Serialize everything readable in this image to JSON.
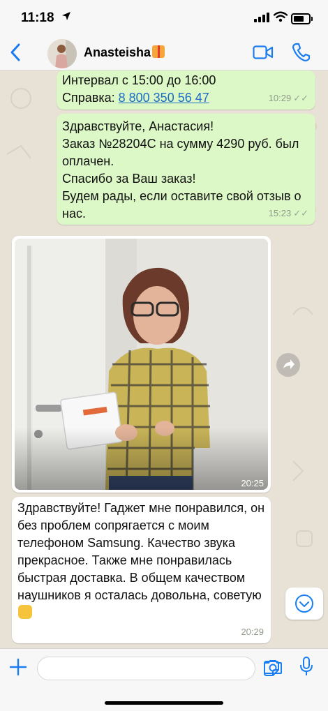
{
  "status_bar": {
    "time": "11:18",
    "location_arrow": "location-arrow-icon"
  },
  "header": {
    "contact_name": "Anasteisha",
    "contact_emoji": "gift-icon",
    "back": "chevron-left-icon",
    "video_call": "video-icon",
    "voice_call": "phone-icon"
  },
  "messages": [
    {
      "direction": "out",
      "text": "Интервал с 15:00 до 16:00\nСправка: ",
      "link": "8 800 350 56 47",
      "time": "10:29",
      "ticks": "✓✓"
    },
    {
      "direction": "out",
      "text": "Здравствуйте, Анастасия!\nЗаказ №28204С на сумму 4290 руб. был оплачен.\nСпасибо за Ваш заказ!\nБудем рады, если оставите свой отзыв о нас.",
      "time": "15:23",
      "ticks": "✓✓"
    },
    {
      "direction": "in",
      "type": "photo",
      "time": "20:25"
    },
    {
      "direction": "in",
      "text": "Здравствуйте! Гаджет мне понравился, он без проблем сопрягается с моим телефоном Samsung. Качество звука прекрасное. Также мне понравилась быстрая доставка. В общем качеством наушников я осталась довольна, советую",
      "emoji": "thumbs-up-icon",
      "time": "20:29"
    }
  ],
  "input_bar": {
    "placeholder": "",
    "icons": [
      "plus-icon",
      "sticker-icon",
      "camera-icon",
      "microphone-icon"
    ]
  },
  "colors": {
    "outgoing_bubble": "#dcf8c6",
    "incoming_bubble": "#ffffff",
    "accent": "#1a7ef2",
    "chat_background": "#e7e1d6"
  }
}
